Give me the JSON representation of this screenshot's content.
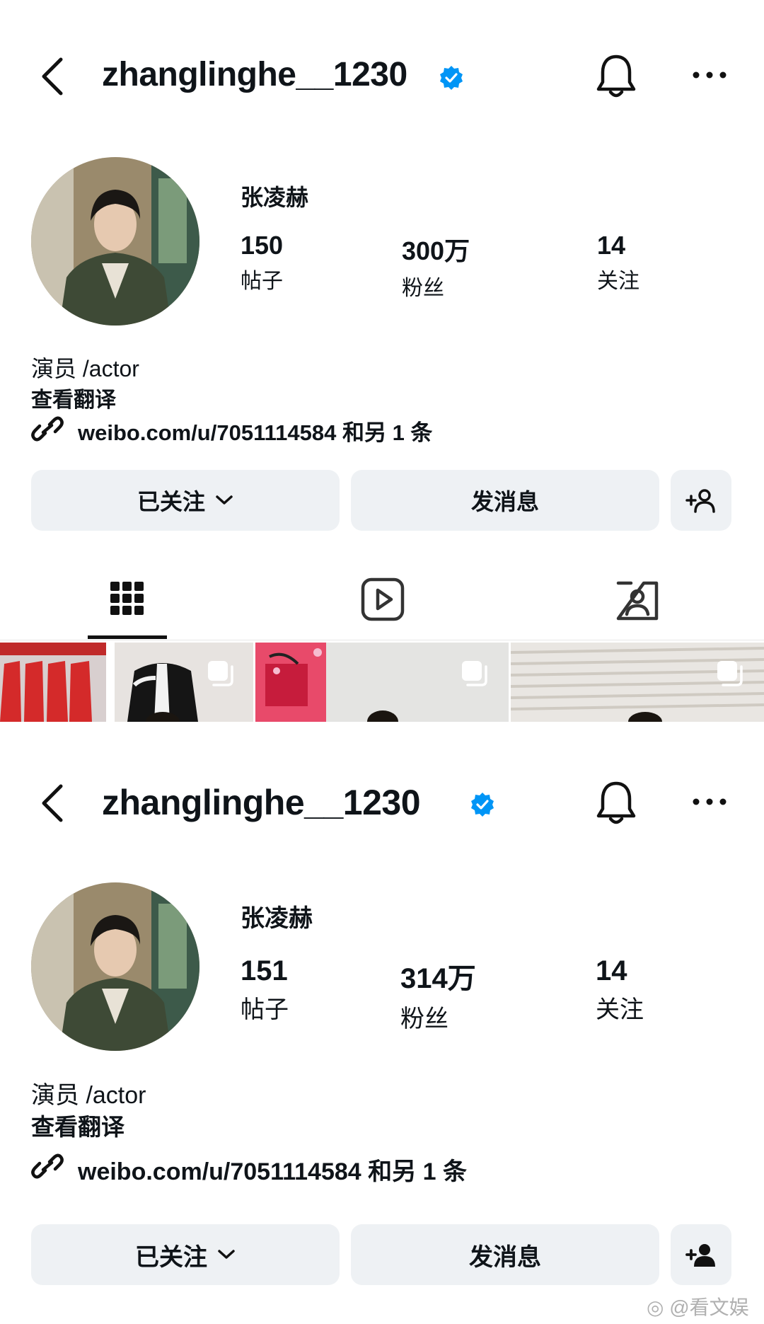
{
  "watermark": "@看文娱",
  "profiles": [
    {
      "username": "zhanglinghe__1230",
      "display_name": "张凌赫",
      "stats": {
        "posts": {
          "value": "150",
          "label": "帖子"
        },
        "followers": {
          "value": "300万",
          "label": "粉丝"
        },
        "following": {
          "value": "14",
          "label": "关注"
        }
      },
      "bio": "演员 /actor",
      "translate_label": "查看翻译",
      "link_text": "weibo.com/u/7051114584 和另 1 条",
      "buttons": {
        "following": "已关注",
        "message": "发消息"
      },
      "tabs": [
        "grid-icon",
        "reels-icon",
        "tagged-icon"
      ]
    },
    {
      "username": "zhanglinghe__1230",
      "display_name": "张凌赫",
      "stats": {
        "posts": {
          "value": "151",
          "label": "帖子"
        },
        "followers": {
          "value": "314万",
          "label": "粉丝"
        },
        "following": {
          "value": "14",
          "label": "关注"
        }
      },
      "bio": "演员 /actor",
      "translate_label": "查看翻译",
      "link_text": "weibo.com/u/7051114584 和另 1 条",
      "buttons": {
        "following": "已关注",
        "message": "发消息"
      }
    }
  ],
  "colors": {
    "verified": "#0095f6",
    "button_bg": "#eef1f4",
    "text": "#0f1419"
  }
}
